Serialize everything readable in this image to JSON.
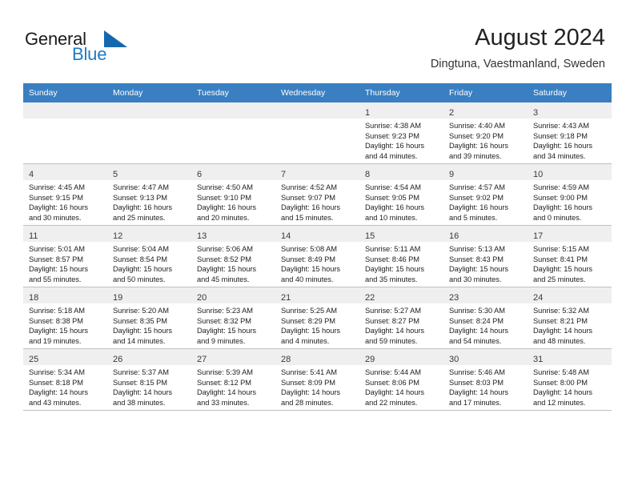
{
  "brand": {
    "name_part1": "General",
    "name_part2": "Blue",
    "triangle_color": "#1567ae",
    "blue_color": "#1f7ac4"
  },
  "header": {
    "title": "August 2024",
    "subtitle": "Dingtuna, Vaestmanland, Sweden"
  },
  "calendar": {
    "header_color": "#3a7fc1",
    "weekday_headers": [
      "Sunday",
      "Monday",
      "Tuesday",
      "Wednesday",
      "Thursday",
      "Friday",
      "Saturday"
    ],
    "weeks": [
      [
        {
          "day": "",
          "lines": []
        },
        {
          "day": "",
          "lines": []
        },
        {
          "day": "",
          "lines": []
        },
        {
          "day": "",
          "lines": []
        },
        {
          "day": "1",
          "lines": [
            "Sunrise: 4:38 AM",
            "Sunset: 9:23 PM",
            "Daylight: 16 hours",
            "and 44 minutes."
          ]
        },
        {
          "day": "2",
          "lines": [
            "Sunrise: 4:40 AM",
            "Sunset: 9:20 PM",
            "Daylight: 16 hours",
            "and 39 minutes."
          ]
        },
        {
          "day": "3",
          "lines": [
            "Sunrise: 4:43 AM",
            "Sunset: 9:18 PM",
            "Daylight: 16 hours",
            "and 34 minutes."
          ]
        }
      ],
      [
        {
          "day": "4",
          "lines": [
            "Sunrise: 4:45 AM",
            "Sunset: 9:15 PM",
            "Daylight: 16 hours",
            "and 30 minutes."
          ]
        },
        {
          "day": "5",
          "lines": [
            "Sunrise: 4:47 AM",
            "Sunset: 9:13 PM",
            "Daylight: 16 hours",
            "and 25 minutes."
          ]
        },
        {
          "day": "6",
          "lines": [
            "Sunrise: 4:50 AM",
            "Sunset: 9:10 PM",
            "Daylight: 16 hours",
            "and 20 minutes."
          ]
        },
        {
          "day": "7",
          "lines": [
            "Sunrise: 4:52 AM",
            "Sunset: 9:07 PM",
            "Daylight: 16 hours",
            "and 15 minutes."
          ]
        },
        {
          "day": "8",
          "lines": [
            "Sunrise: 4:54 AM",
            "Sunset: 9:05 PM",
            "Daylight: 16 hours",
            "and 10 minutes."
          ]
        },
        {
          "day": "9",
          "lines": [
            "Sunrise: 4:57 AM",
            "Sunset: 9:02 PM",
            "Daylight: 16 hours",
            "and 5 minutes."
          ]
        },
        {
          "day": "10",
          "lines": [
            "Sunrise: 4:59 AM",
            "Sunset: 9:00 PM",
            "Daylight: 16 hours",
            "and 0 minutes."
          ]
        }
      ],
      [
        {
          "day": "11",
          "lines": [
            "Sunrise: 5:01 AM",
            "Sunset: 8:57 PM",
            "Daylight: 15 hours",
            "and 55 minutes."
          ]
        },
        {
          "day": "12",
          "lines": [
            "Sunrise: 5:04 AM",
            "Sunset: 8:54 PM",
            "Daylight: 15 hours",
            "and 50 minutes."
          ]
        },
        {
          "day": "13",
          "lines": [
            "Sunrise: 5:06 AM",
            "Sunset: 8:52 PM",
            "Daylight: 15 hours",
            "and 45 minutes."
          ]
        },
        {
          "day": "14",
          "lines": [
            "Sunrise: 5:08 AM",
            "Sunset: 8:49 PM",
            "Daylight: 15 hours",
            "and 40 minutes."
          ]
        },
        {
          "day": "15",
          "lines": [
            "Sunrise: 5:11 AM",
            "Sunset: 8:46 PM",
            "Daylight: 15 hours",
            "and 35 minutes."
          ]
        },
        {
          "day": "16",
          "lines": [
            "Sunrise: 5:13 AM",
            "Sunset: 8:43 PM",
            "Daylight: 15 hours",
            "and 30 minutes."
          ]
        },
        {
          "day": "17",
          "lines": [
            "Sunrise: 5:15 AM",
            "Sunset: 8:41 PM",
            "Daylight: 15 hours",
            "and 25 minutes."
          ]
        }
      ],
      [
        {
          "day": "18",
          "lines": [
            "Sunrise: 5:18 AM",
            "Sunset: 8:38 PM",
            "Daylight: 15 hours",
            "and 19 minutes."
          ]
        },
        {
          "day": "19",
          "lines": [
            "Sunrise: 5:20 AM",
            "Sunset: 8:35 PM",
            "Daylight: 15 hours",
            "and 14 minutes."
          ]
        },
        {
          "day": "20",
          "lines": [
            "Sunrise: 5:23 AM",
            "Sunset: 8:32 PM",
            "Daylight: 15 hours",
            "and 9 minutes."
          ]
        },
        {
          "day": "21",
          "lines": [
            "Sunrise: 5:25 AM",
            "Sunset: 8:29 PM",
            "Daylight: 15 hours",
            "and 4 minutes."
          ]
        },
        {
          "day": "22",
          "lines": [
            "Sunrise: 5:27 AM",
            "Sunset: 8:27 PM",
            "Daylight: 14 hours",
            "and 59 minutes."
          ]
        },
        {
          "day": "23",
          "lines": [
            "Sunrise: 5:30 AM",
            "Sunset: 8:24 PM",
            "Daylight: 14 hours",
            "and 54 minutes."
          ]
        },
        {
          "day": "24",
          "lines": [
            "Sunrise: 5:32 AM",
            "Sunset: 8:21 PM",
            "Daylight: 14 hours",
            "and 48 minutes."
          ]
        }
      ],
      [
        {
          "day": "25",
          "lines": [
            "Sunrise: 5:34 AM",
            "Sunset: 8:18 PM",
            "Daylight: 14 hours",
            "and 43 minutes."
          ]
        },
        {
          "day": "26",
          "lines": [
            "Sunrise: 5:37 AM",
            "Sunset: 8:15 PM",
            "Daylight: 14 hours",
            "and 38 minutes."
          ]
        },
        {
          "day": "27",
          "lines": [
            "Sunrise: 5:39 AM",
            "Sunset: 8:12 PM",
            "Daylight: 14 hours",
            "and 33 minutes."
          ]
        },
        {
          "day": "28",
          "lines": [
            "Sunrise: 5:41 AM",
            "Sunset: 8:09 PM",
            "Daylight: 14 hours",
            "and 28 minutes."
          ]
        },
        {
          "day": "29",
          "lines": [
            "Sunrise: 5:44 AM",
            "Sunset: 8:06 PM",
            "Daylight: 14 hours",
            "and 22 minutes."
          ]
        },
        {
          "day": "30",
          "lines": [
            "Sunrise: 5:46 AM",
            "Sunset: 8:03 PM",
            "Daylight: 14 hours",
            "and 17 minutes."
          ]
        },
        {
          "day": "31",
          "lines": [
            "Sunrise: 5:48 AM",
            "Sunset: 8:00 PM",
            "Daylight: 14 hours",
            "and 12 minutes."
          ]
        }
      ]
    ]
  }
}
